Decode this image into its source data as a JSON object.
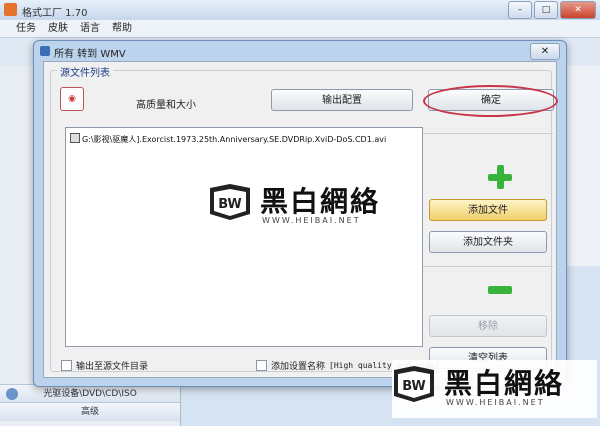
{
  "app": {
    "title": "格式工厂 1.70",
    "menu": [
      "任务",
      "皮肤",
      "语言",
      "帮助"
    ],
    "window_buttons": [
      "–",
      "□",
      "✕"
    ],
    "sidebar": [
      "光驱设备\\DVD\\CD\\ISO",
      "高级"
    ]
  },
  "dialog": {
    "title": "所有 转到 WMV",
    "close_label": "✕",
    "group_label": "源文件列表",
    "quality_label": "高质量和大小",
    "output_config_label": "输出配置",
    "ok_label": "确定",
    "files": [
      "G:\\影视\\驱魔人].Exorcist.1973.25th.Anniversary.SE.DVDRip.XviD-DoS.CD1.avi"
    ],
    "add_file_label": "添加文件",
    "add_folder_label": "添加文件夹",
    "remove_label": "移除",
    "clear_list_label": "清空列表",
    "output_to_source_label": "输出至源文件目录",
    "add_setting_name_label": "添加设置名称",
    "setting_name_value": "[High quality and size]"
  },
  "watermark": {
    "text": "黑白網絡",
    "url": "WWW.HEIBAI.NET"
  },
  "colors": {
    "accent_green": "#39b43a",
    "highlight_ring": "#c8344a",
    "primary_button": "#f0cf6a"
  }
}
